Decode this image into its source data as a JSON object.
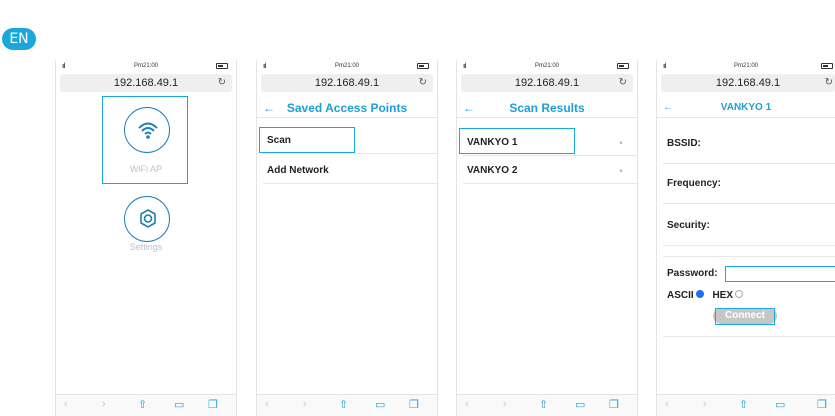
{
  "language_badge": "EN",
  "common": {
    "time": "Pm21:00",
    "url": "192.168.49.1",
    "signal": "ııl"
  },
  "screen1": {
    "wifi_label": "WiFi AP",
    "settings_label": "Settings"
  },
  "screen2": {
    "title": "Saved Access Points",
    "items": [
      {
        "label": "Scan"
      },
      {
        "label": "Add Network"
      }
    ]
  },
  "screen3": {
    "title": "Scan Results",
    "items": [
      {
        "label": "VANKYO 1"
      },
      {
        "label": "VANKYO 2"
      }
    ]
  },
  "screen4": {
    "title": "VANKYO 1",
    "fields": [
      {
        "label": "BSSID:"
      },
      {
        "label": "Frequency:"
      },
      {
        "label": "Security:"
      }
    ],
    "password_label": "Password:",
    "password_value": "",
    "ascii_label": "ASCII",
    "hex_label": "HEX",
    "connect_label": "Connect"
  },
  "colors": {
    "accent": "#1aa7dc",
    "title_blue": "#1d9fd8",
    "icon_ring": "#1d7fb3"
  }
}
